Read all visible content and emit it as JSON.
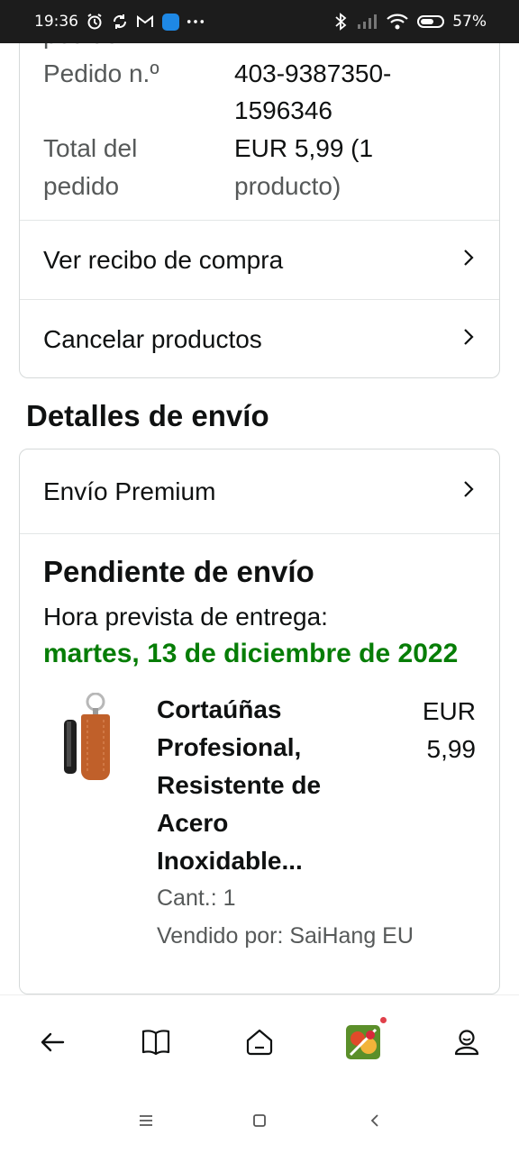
{
  "status_bar": {
    "time": "19:36",
    "battery": "57%",
    "icons": [
      "alarm-icon",
      "sync-icon",
      "gmail-icon",
      "app-icon",
      "more-dots-icon",
      "bluetooth-icon",
      "signal-icon",
      "wifi-icon",
      "battery-icon"
    ]
  },
  "order": {
    "cut_label": "pedido",
    "number_label": "Pedido n.º",
    "number_value": "403-9387350-1596346",
    "number_line1": "403-9387350-",
    "number_line2": "1596346",
    "total_label_line1": "Total del",
    "total_label_line2": "pedido",
    "total_value_line1": "EUR 5,99 (1",
    "total_value_line2": "producto)",
    "actions": [
      {
        "label": "Ver recibo de compra",
        "icon": "chevron-right-icon"
      },
      {
        "label": "Cancelar productos",
        "icon": "chevron-right-icon"
      }
    ]
  },
  "shipping": {
    "section_title": "Detalles de envío",
    "method": "Envío Premium",
    "status_title": "Pendiente de envío",
    "eta_label": "Hora prevista de entrega:",
    "eta_date": "martes, 13 de diciembre de 2022",
    "eta_color": "#067d06",
    "product": {
      "name_lines": [
        "Cortaúñas",
        "Profesional,",
        "Resistente de",
        "Acero",
        "Inoxidable..."
      ],
      "price_line1": "EUR",
      "price_line2": "5,99",
      "quantity": "Cant.: 1",
      "seller": "Vendido por: SaiHang EU"
    }
  },
  "bottom_nav": {
    "items": [
      "back-arrow-icon",
      "book-icon",
      "home-icon",
      "fruit-game-app-icon",
      "profile-icon"
    ]
  },
  "system_nav": {
    "items": [
      "menu-icon",
      "home-square-icon",
      "back-chevron-icon"
    ]
  }
}
